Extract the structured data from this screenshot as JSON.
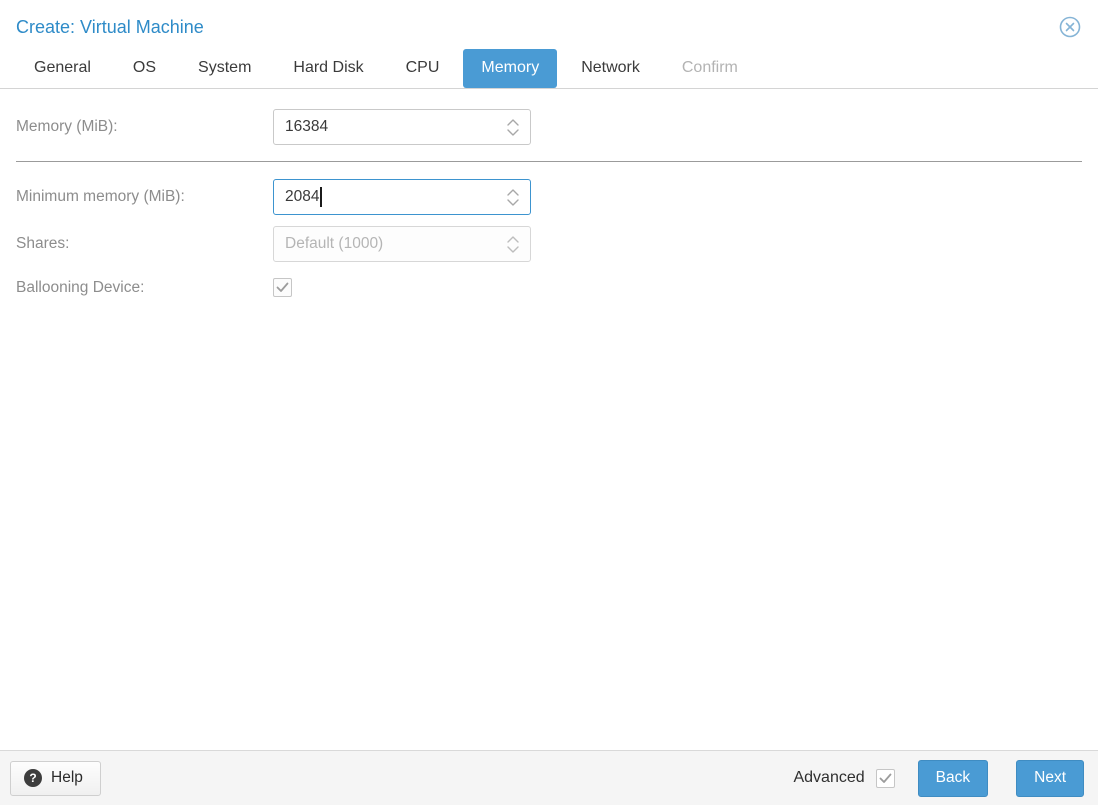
{
  "window": {
    "title": "Create: Virtual Machine"
  },
  "tabs": [
    {
      "label": "General",
      "state": "normal"
    },
    {
      "label": "OS",
      "state": "normal"
    },
    {
      "label": "System",
      "state": "normal"
    },
    {
      "label": "Hard Disk",
      "state": "normal"
    },
    {
      "label": "CPU",
      "state": "normal"
    },
    {
      "label": "Memory",
      "state": "active"
    },
    {
      "label": "Network",
      "state": "normal"
    },
    {
      "label": "Confirm",
      "state": "disabled"
    }
  ],
  "active_tab": "Memory",
  "form": {
    "memory": {
      "label": "Memory (MiB):",
      "value": "16384"
    },
    "min_memory": {
      "label": "Minimum memory (MiB):",
      "value": "2084",
      "focused": true
    },
    "shares": {
      "label": "Shares:",
      "value": "Default (1000)",
      "disabled": true
    },
    "ballooning": {
      "label": "Ballooning Device:",
      "checked": true
    }
  },
  "footer": {
    "help_label": "Help",
    "help_icon": "?",
    "advanced_label": "Advanced",
    "advanced_checked": true,
    "back_label": "Back",
    "next_label": "Next"
  },
  "colors": {
    "accent": "#4a9bd4",
    "title_text": "#2e8bc8",
    "label_text": "#8d8d8d",
    "focused_border": "#3d94cf"
  }
}
